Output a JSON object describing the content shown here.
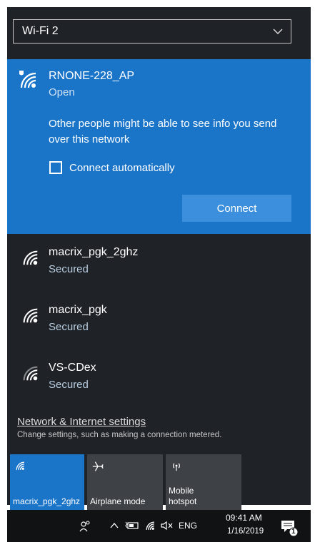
{
  "adapter": {
    "selected": "Wi-Fi 2"
  },
  "active_network": {
    "name": "RNONE-228_AP",
    "status": "Open",
    "warning": "Other people might be able to see info you send over this network",
    "connect_auto_label": "Connect automatically",
    "connect_auto_checked": false,
    "connect_label": "Connect"
  },
  "networks": [
    {
      "name": "macrix_pgk_2ghz",
      "status": "Secured"
    },
    {
      "name": "macrix_pgk",
      "status": "Secured"
    },
    {
      "name": "VS-CDex",
      "status": "Secured"
    }
  ],
  "settings": {
    "link": "Network & Internet settings",
    "description": "Change settings, such as making a connection metered."
  },
  "quick_actions": [
    {
      "label": "macrix_pgk_2ghz",
      "icon": "wifi-icon",
      "active": true
    },
    {
      "label": "Airplane mode",
      "icon": "airplane-icon",
      "active": false
    },
    {
      "label": "Mobile hotspot",
      "icon": "hotspot-icon",
      "active": false
    }
  ],
  "taskbar": {
    "language": "ENG",
    "time": "09:41 AM",
    "date": "1/16/2019",
    "notification_count": "1"
  },
  "colors": {
    "accent": "#1a74c8",
    "panel": "#1f2328",
    "tile_inactive": "#3e4247",
    "taskbar": "#101214"
  }
}
